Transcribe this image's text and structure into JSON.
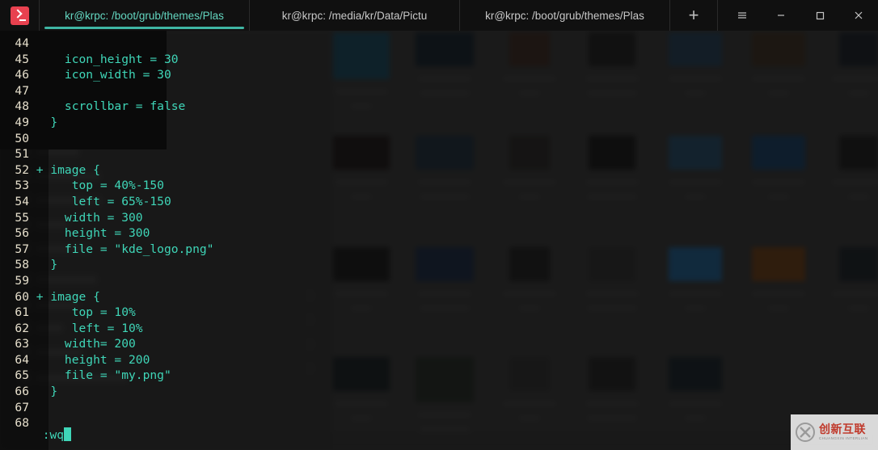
{
  "window": {
    "app_icon": "terminal-icon",
    "tabs": [
      {
        "label": "kr@krpc: /boot/grub/themes/Plas",
        "active": true
      },
      {
        "label": "kr@krpc: /media/kr/Data/Pictu",
        "active": false
      },
      {
        "label": "kr@krpc: /boot/grub/themes/Plas",
        "active": false
      }
    ],
    "new_tab_label": "+",
    "controls": [
      {
        "name": "menu-button",
        "glyph": "≡"
      },
      {
        "name": "minimize-button",
        "glyph": "−"
      },
      {
        "name": "maximize-button",
        "glyph": "□"
      },
      {
        "name": "close-button",
        "glyph": "×"
      }
    ]
  },
  "editor": {
    "lines": [
      {
        "num": "44",
        "marker": "",
        "text": ""
      },
      {
        "num": "45",
        "marker": "",
        "text": "  icon_height = 30"
      },
      {
        "num": "46",
        "marker": "",
        "text": "  icon_width = 30"
      },
      {
        "num": "47",
        "marker": "",
        "text": ""
      },
      {
        "num": "48",
        "marker": "",
        "text": "  scrollbar = false"
      },
      {
        "num": "49",
        "marker": "",
        "text": "}"
      },
      {
        "num": "50",
        "marker": "",
        "text": ""
      },
      {
        "num": "51",
        "marker": "",
        "text": ""
      },
      {
        "num": "52",
        "marker": "+",
        "text": "image {"
      },
      {
        "num": "53",
        "marker": "",
        "text": "   top = 40%-150"
      },
      {
        "num": "54",
        "marker": "",
        "text": "   left = 65%-150"
      },
      {
        "num": "55",
        "marker": "",
        "text": "  width = 300"
      },
      {
        "num": "56",
        "marker": "",
        "text": "  height = 300"
      },
      {
        "num": "57",
        "marker": "",
        "text": "  file = \"kde_logo.png\""
      },
      {
        "num": "58",
        "marker": "",
        "text": "}"
      },
      {
        "num": "59",
        "marker": "",
        "text": ""
      },
      {
        "num": "60",
        "marker": "+",
        "text": "image {"
      },
      {
        "num": "61",
        "marker": "",
        "text": "   top = 10%"
      },
      {
        "num": "62",
        "marker": "",
        "text": "   left = 10%"
      },
      {
        "num": "63",
        "marker": "",
        "text": "  width= 200"
      },
      {
        "num": "64",
        "marker": "",
        "text": "  height = 200"
      },
      {
        "num": "65",
        "marker": "",
        "text": "  file = \"my.png\""
      },
      {
        "num": "66",
        "marker": "",
        "text": "}"
      },
      {
        "num": "67",
        "marker": "",
        "text": ""
      },
      {
        "num": "68",
        "marker": "",
        "text": ""
      }
    ],
    "command_line": ":wq"
  },
  "watermark": {
    "cn": "创新互联",
    "en": "CHUANGXIN INTERLIAN"
  },
  "colors": {
    "accent_teal": "#3fd6b8",
    "tab_active_underline": "#3fb6a4",
    "line_number": "#e6dfcc",
    "titlebar_bg": "#101010",
    "terminal_bg": "#0a0a0a",
    "app_icon_red": "#e8414f",
    "watermark_red": "#c0392b"
  }
}
